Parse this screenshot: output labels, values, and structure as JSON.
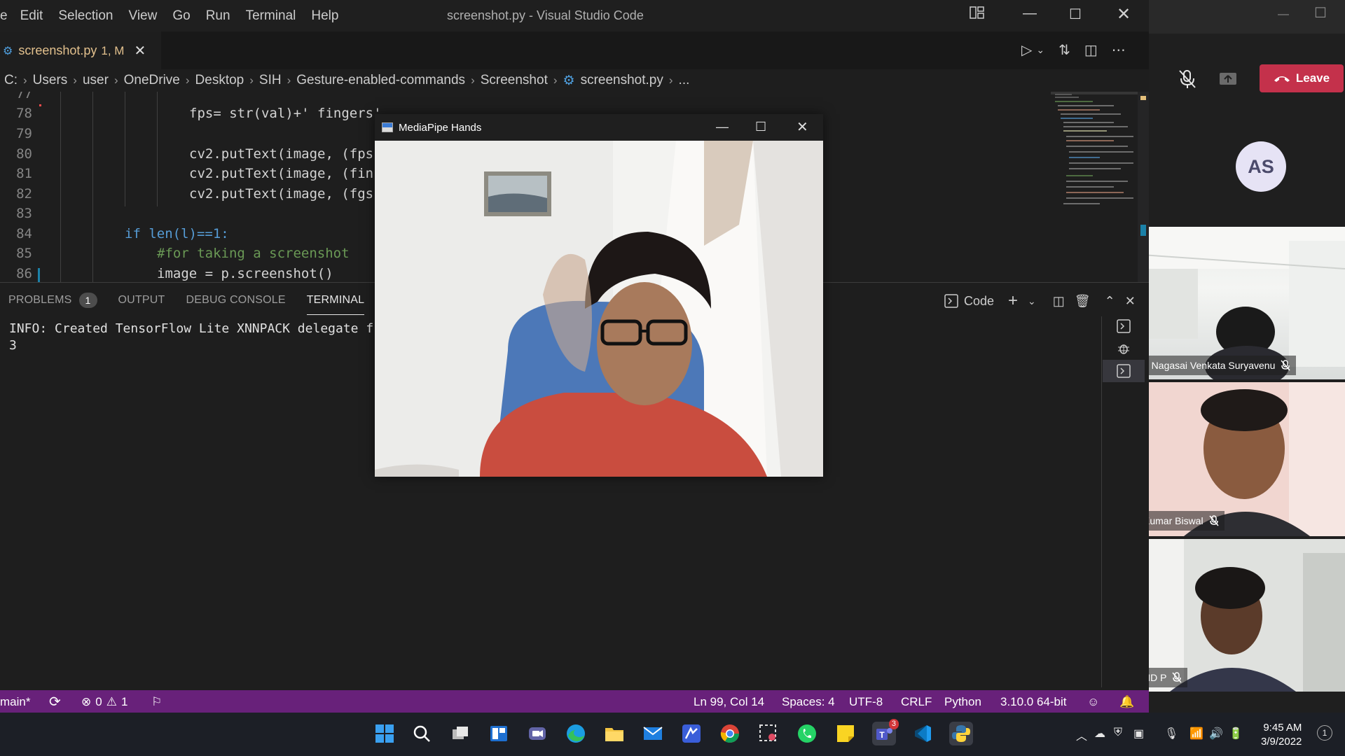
{
  "vscode": {
    "menu": [
      "e",
      "Edit",
      "Selection",
      "View",
      "Go",
      "Run",
      "Terminal",
      "Help"
    ],
    "window_title": "screenshot.py - Visual Studio Code",
    "tab": {
      "filename": "screenshot.py",
      "modified": "1, M"
    },
    "breadcrumb": [
      "C:",
      "Users",
      "user",
      "OneDrive",
      "Desktop",
      "SIH",
      "Gesture-enabled-commands",
      "Screenshot",
      "screenshot.py",
      "..."
    ],
    "code_lines": [
      {
        "num": "77",
        "text": ""
      },
      {
        "num": "78",
        "text": "fps= str(val)+' fingers'"
      },
      {
        "num": "79",
        "text": ""
      },
      {
        "num": "80",
        "text": "cv2.putText(image, (fps"
      },
      {
        "num": "81",
        "text": "cv2.putText(image, (fin"
      },
      {
        "num": "82",
        "text": "cv2.putText(image, (fgs"
      },
      {
        "num": "83",
        "text": ""
      },
      {
        "num": "84",
        "text": "if len(l)==1:"
      },
      {
        "num": "85",
        "text": "#for taking a screenshot"
      },
      {
        "num": "86",
        "text": "image = p.screenshot()"
      }
    ],
    "panel": {
      "tabs": [
        "PROBLEMS",
        "OUTPUT",
        "DEBUG CONSOLE",
        "TERMINAL"
      ],
      "problems_count": "1",
      "terminal_profile": "Code",
      "terminal_lines": [
        "INFO: Created TensorFlow Lite XNNPACK delegate f",
        "3"
      ]
    },
    "status": {
      "branch": "main*",
      "errors": "0",
      "warnings": "1",
      "position": "Ln 99, Col 14",
      "spaces": "Spaces: 4",
      "encoding": "UTF-8",
      "eol": "CRLF",
      "language": "Python",
      "interpreter": "3.10.0 64-bit"
    }
  },
  "mediapipe": {
    "title": "MediaPipe Hands"
  },
  "teams": {
    "leave_label": "Leave",
    "avatar_initials": "AS",
    "participants": [
      {
        "name": "n Nagasai Venkata Suryavenu"
      },
      {
        "name": "Kumar Biswal"
      },
      {
        "name": "ND P"
      }
    ]
  },
  "taskbar": {
    "time": "9:45 AM",
    "date": "3/9/2022",
    "teams_badge": "3"
  },
  "colors": {
    "statusbar": "#68217a",
    "leave": "#c4314b",
    "editor_bg": "#1e1e1e"
  }
}
